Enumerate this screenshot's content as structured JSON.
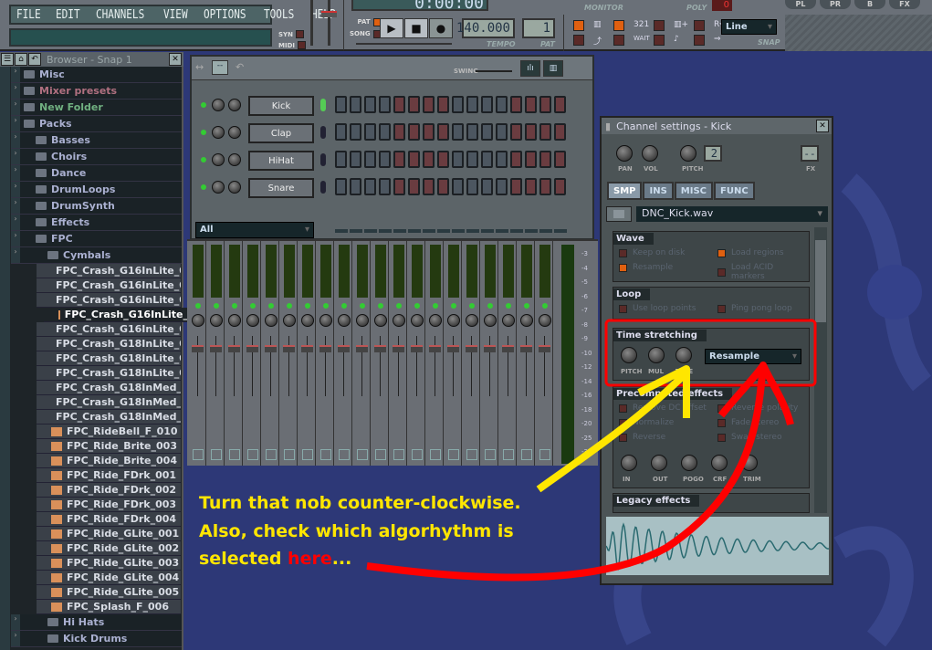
{
  "menu": [
    "FILE",
    "EDIT",
    "CHANNELS",
    "VIEW",
    "OPTIONS",
    "TOOLS",
    "HELP"
  ],
  "transport": {
    "pat": "PAT",
    "song": "SONG",
    "syn": "SYN",
    "midi": "MIDI",
    "time": "0:00:00",
    "monitor": "MONITOR",
    "poly": "POLY",
    "poly_value": "0",
    "tempo_value": "140.000",
    "tempo_label": "TEMPO",
    "pat_label": "PAT",
    "pat_value": "1",
    "snap_value": "Line",
    "snap_label": "SNAP",
    "right_buttons": [
      "PL",
      "PR",
      "B",
      "FX"
    ]
  },
  "browser": {
    "title": "Browser - Snap 1",
    "folders": [
      {
        "label": "Misc",
        "color": "#aab0d0",
        "indent": 0
      },
      {
        "label": "Mixer presets",
        "color": "#b07080",
        "indent": 0
      },
      {
        "label": "New Folder",
        "color": "#70b080",
        "indent": 0
      },
      {
        "label": "Packs",
        "color": "#aab0d0",
        "indent": 0
      },
      {
        "label": "Basses",
        "color": "#aab0d0",
        "indent": 1
      },
      {
        "label": "Choirs",
        "color": "#aab0d0",
        "indent": 1
      },
      {
        "label": "Dance",
        "color": "#aab0d0",
        "indent": 1
      },
      {
        "label": "DrumLoops",
        "color": "#aab0d0",
        "indent": 1
      },
      {
        "label": "DrumSynth",
        "color": "#aab0d0",
        "indent": 1
      },
      {
        "label": "Effects",
        "color": "#aab0d0",
        "indent": 1
      },
      {
        "label": "FPC",
        "color": "#aab0d0",
        "indent": 1
      },
      {
        "label": "Cymbals",
        "color": "#aab0d0",
        "indent": 2
      }
    ],
    "files": [
      "FPC_Crash_G16InLite_0",
      "FPC_Crash_G16InLite_0",
      "FPC_Crash_G16InLite_0",
      "FPC_Crash_G16InLite_",
      "FPC_Crash_G16InLite_0",
      "FPC_Crash_G18InLite_0",
      "FPC_Crash_G18InLite_0",
      "FPC_Crash_G18InLite_0",
      "FPC_Crash_G18InMed_0",
      "FPC_Crash_G18InMed_0",
      "FPC_Crash_G18InMed_0",
      "FPC_RideBell_F_010",
      "FPC_Ride_Brite_003",
      "FPC_Ride_Brite_004",
      "FPC_Ride_FDrk_001",
      "FPC_Ride_FDrk_002",
      "FPC_Ride_FDrk_003",
      "FPC_Ride_FDrk_004",
      "FPC_Ride_GLite_001",
      "FPC_Ride_GLite_002",
      "FPC_Ride_GLite_003",
      "FPC_Ride_GLite_004",
      "FPC_Ride_GLite_005",
      "FPC_Splash_F_006"
    ],
    "selected_file_index": 3,
    "bottom_folders": [
      "Hi Hats",
      "Kick Drums"
    ]
  },
  "sequencer": {
    "swing_label": "SWING",
    "channels": [
      "Kick",
      "Clap",
      "HiHat",
      "Snare"
    ],
    "filter": "All",
    "steps": 16
  },
  "mixer": {
    "tracks": 20,
    "scale": [
      "-3",
      "-4",
      "-5",
      "-6",
      "-7",
      "-8",
      "-9",
      "-10",
      "-12",
      "-14",
      "-16",
      "-18",
      "-20",
      "-25",
      "-30"
    ]
  },
  "channel_settings": {
    "title": "Channel settings - Kick",
    "knobs": [
      "PAN",
      "VOL",
      "PITCH"
    ],
    "pitch_range": "2",
    "fx_label": "FX",
    "fx_value": "--",
    "tabs": [
      "SMP",
      "INS",
      "MISC",
      "FUNC"
    ],
    "active_tab": "SMP",
    "sample": "DNC_Kick.wav",
    "wave": {
      "title": "Wave",
      "options": [
        {
          "label": "Keep on disk",
          "on": false
        },
        {
          "label": "Load regions",
          "on": true
        },
        {
          "label": "Resample",
          "on": true
        },
        {
          "label": "Load ACID markers",
          "on": false
        }
      ]
    },
    "loop": {
      "title": "Loop",
      "options": [
        {
          "label": "Use loop points",
          "on": false
        },
        {
          "label": "Ping pong loop",
          "on": false
        }
      ]
    },
    "time_stretching": {
      "title": "Time stretching",
      "knobs": [
        "PITCH",
        "MUL",
        "TIME"
      ],
      "mode": "Resample"
    },
    "precomputed": {
      "title": "Precomputed effects",
      "options": [
        {
          "label": "Remove DC offset",
          "on": false
        },
        {
          "label": "Reverse polarity",
          "on": false
        },
        {
          "label": "Normalize",
          "on": false
        },
        {
          "label": "Fade stereo",
          "on": false
        },
        {
          "label": "Reverse",
          "on": false
        },
        {
          "label": "Swap stereo",
          "on": false
        }
      ],
      "knobs": [
        "IN",
        "OUT",
        "POGO",
        "CRF",
        "TRIM"
      ]
    },
    "legacy": {
      "title": "Legacy effects"
    }
  },
  "annotation": {
    "line1": "Turn that nob counter-clockwise.",
    "line2": "Also, check which algorhythm is",
    "line3_prefix": "selected ",
    "line3_highlight": "here",
    "line3_suffix": "...",
    "yellow": "#ffe600",
    "red": "#ff0000"
  }
}
